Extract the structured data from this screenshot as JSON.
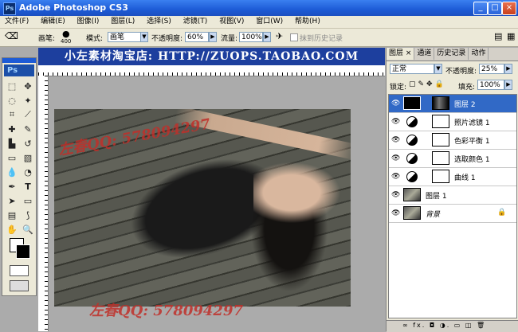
{
  "titlebar": {
    "badge": "Ps",
    "title": "Adobe Photoshop CS3",
    "min": "_",
    "max": "□",
    "close": "×"
  },
  "menu": [
    "文件(F)",
    "编辑(E)",
    "图像(I)",
    "图层(L)",
    "选择(S)",
    "滤镜(T)",
    "视图(V)",
    "窗口(W)",
    "帮助(H)"
  ],
  "options": {
    "brush_label": "画笔:",
    "brush_size": "400",
    "mode_label": "模式:",
    "mode_value": "画笔",
    "opacity_label": "不透明度:",
    "opacity_value": "60%",
    "flow_label": "流量:",
    "flow_value": "100%",
    "history_label": "抹到历史记录"
  },
  "banner": "小左素材淘宝店: HTTP://ZUOPS.TAOBAO.COM",
  "toolbox": {
    "logo": "Ps"
  },
  "watermarks": {
    "upper": "左春QQ: 578094297",
    "lower": "左春QQ: 578094297"
  },
  "panel": {
    "tabs": [
      "图层 ×",
      "通道",
      "历史记录",
      "动作"
    ],
    "blend_mode": "正常",
    "opacity_label": "不透明度:",
    "opacity_value": "25%",
    "lock_label": "锁定:",
    "fill_label": "填充:",
    "fill_value": "100%",
    "layers": [
      {
        "name": "图层 2",
        "selected": true
      },
      {
        "name": "照片滤镜 1",
        "selected": false
      },
      {
        "name": "色彩平衡 1",
        "selected": false
      },
      {
        "name": "选取颜色 1",
        "selected": false
      },
      {
        "name": "曲线 1",
        "selected": false
      },
      {
        "name": "图层 1",
        "selected": false
      },
      {
        "name": "背景",
        "selected": false
      }
    ],
    "footer": "∞  fx.  ◘  ◑.  ▭  ◫  🗑"
  },
  "colors": {
    "titlebar": "#1d5bd6",
    "selected_layer": "#3169c6",
    "banner_bg": "#1d3f9e",
    "watermark": "#c0302a"
  }
}
